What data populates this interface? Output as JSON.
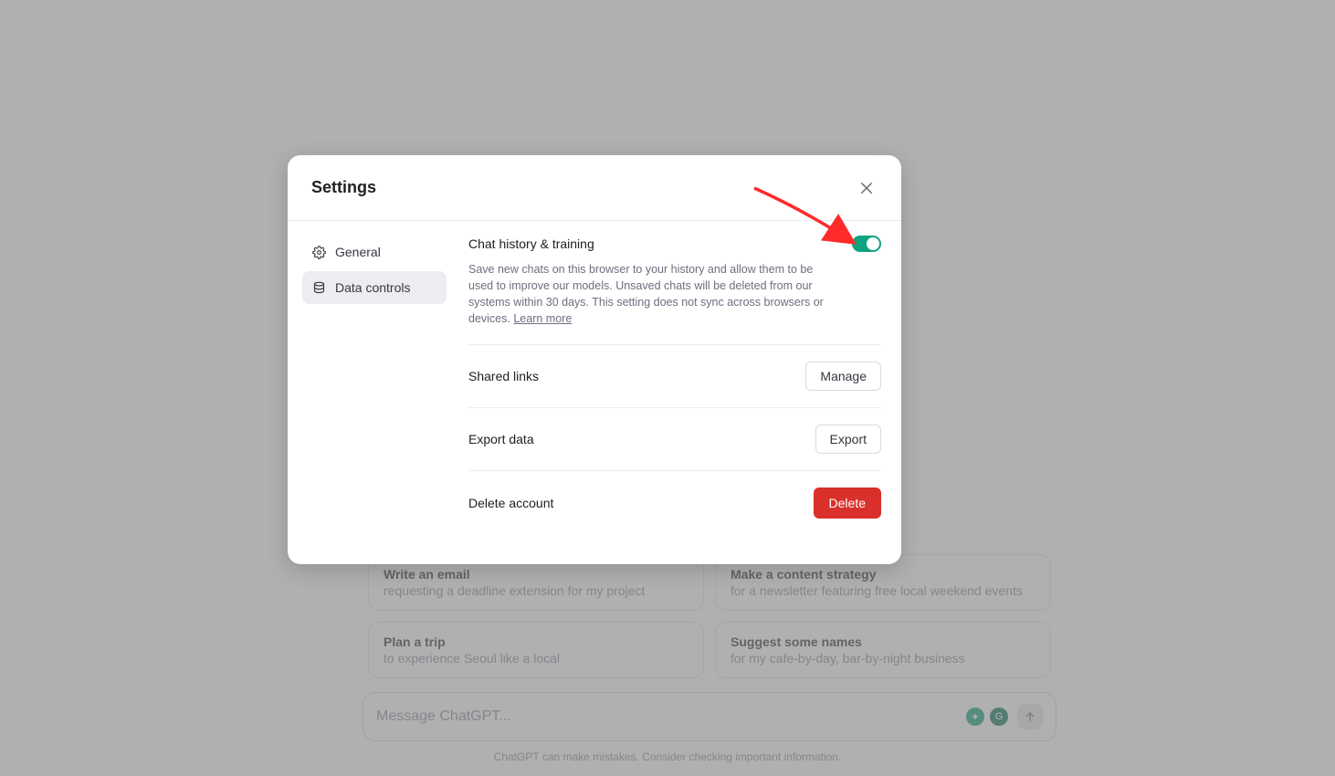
{
  "background": {
    "cards": [
      {
        "title": "Write an email",
        "sub": "requesting a deadline extension for my project"
      },
      {
        "title": "Make a content strategy",
        "sub": "for a newsletter featuring free local weekend events"
      },
      {
        "title": "Plan a trip",
        "sub": "to experience Seoul like a local"
      },
      {
        "title": "Suggest some names",
        "sub": "for my cafe-by-day, bar-by-night business"
      }
    ],
    "message_placeholder": "Message ChatGPT...",
    "disclaimer": "ChatGPT can make mistakes. Consider checking important information."
  },
  "modal": {
    "title": "Settings",
    "sidebar": {
      "items": [
        {
          "label": "General",
          "active": false
        },
        {
          "label": "Data controls",
          "active": true
        }
      ]
    },
    "sections": {
      "history": {
        "title": "Chat history & training",
        "description": "Save new chats on this browser to your history and allow them to be used to improve our models. Unsaved chats will be deleted from our systems within 30 days. This setting does not sync across browsers or devices. ",
        "learn_more": "Learn more",
        "toggle_on": true
      },
      "shared_links": {
        "title": "Shared links",
        "button": "Manage"
      },
      "export_data": {
        "title": "Export data",
        "button": "Export"
      },
      "delete_acct": {
        "title": "Delete account",
        "button": "Delete"
      }
    }
  },
  "annotation": {
    "arrow_color": "#ff2a2a"
  }
}
